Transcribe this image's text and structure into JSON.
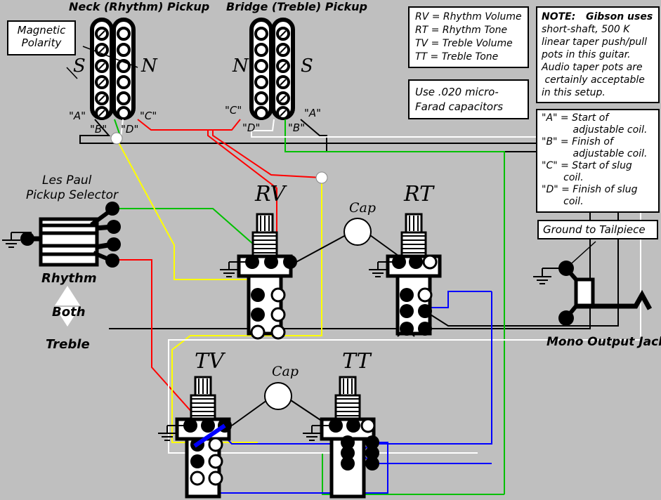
{
  "diagram": {
    "title_neck": "Neck (Rhythm) Pickup",
    "title_bridge": "Bridge (Treble) Pickup",
    "background_color": "#bfbfbf"
  },
  "boxes": {
    "magnetic_polarity": {
      "lines": [
        "Magnetic",
        "Polarity"
      ]
    },
    "legend_abbrev": {
      "lines": [
        "RV = Rhythm Volume",
        "RT = Rhythm Tone",
        "TV = Treble Volume",
        "TT = Treble Tone"
      ]
    },
    "capacitor_note": {
      "lines": [
        "Use .020 micro-",
        "Farad capacitors"
      ]
    },
    "pot_note": {
      "lines": [
        "NOTE:   Gibson uses",
        "short-shaft, 500 K",
        "linear taper push/pull",
        "pots in this guitar.",
        "Audio taper pots are",
        " certainly acceptable",
        "in this setup."
      ]
    },
    "coil_legend": {
      "lines": [
        "\"A\" = Start of",
        "          adjustable coil.",
        "\"B\" = Finish of",
        "          adjustable coil.",
        "\"C\" = Start of slug",
        "       coil.",
        "\"D\" = Finish of slug",
        "       coil."
      ]
    },
    "ground_to_tailpiece": {
      "lines": [
        "Ground to Tailpiece"
      ]
    }
  },
  "labels": {
    "neck_polarity_south": "S",
    "neck_polarity_north": "N",
    "bridge_polarity_north": "N",
    "bridge_polarity_south": "S",
    "neck_A": "\"A\"",
    "neck_B": "\"B\"",
    "neck_C": "\"C\"",
    "neck_D": "\"D\"",
    "bridge_C": "\"C\"",
    "bridge_D": "\"D\"",
    "bridge_A": "\"A\"",
    "bridge_B": "\"B\"",
    "selector_title_l1": "Les Paul",
    "selector_title_l2": "Pickup Selector",
    "switch_rhythm": "Rhythm",
    "switch_both": "Both",
    "switch_treble": "Treble",
    "pot_rv": "RV",
    "pot_rt": "RT",
    "pot_tv": "TV",
    "pot_tt": "TT",
    "cap_top": "Cap",
    "cap_bottom": "Cap",
    "mono_output_jack": "Mono Output Jack"
  },
  "colors": {
    "wire_red": "#ff0000",
    "wire_green": "#00c000",
    "wire_yellow": "#ffff00",
    "wire_blue": "#0000ff",
    "wire_white": "#ffffff",
    "wire_black": "#000000",
    "body": "#ffffff",
    "outline": "#000000"
  }
}
